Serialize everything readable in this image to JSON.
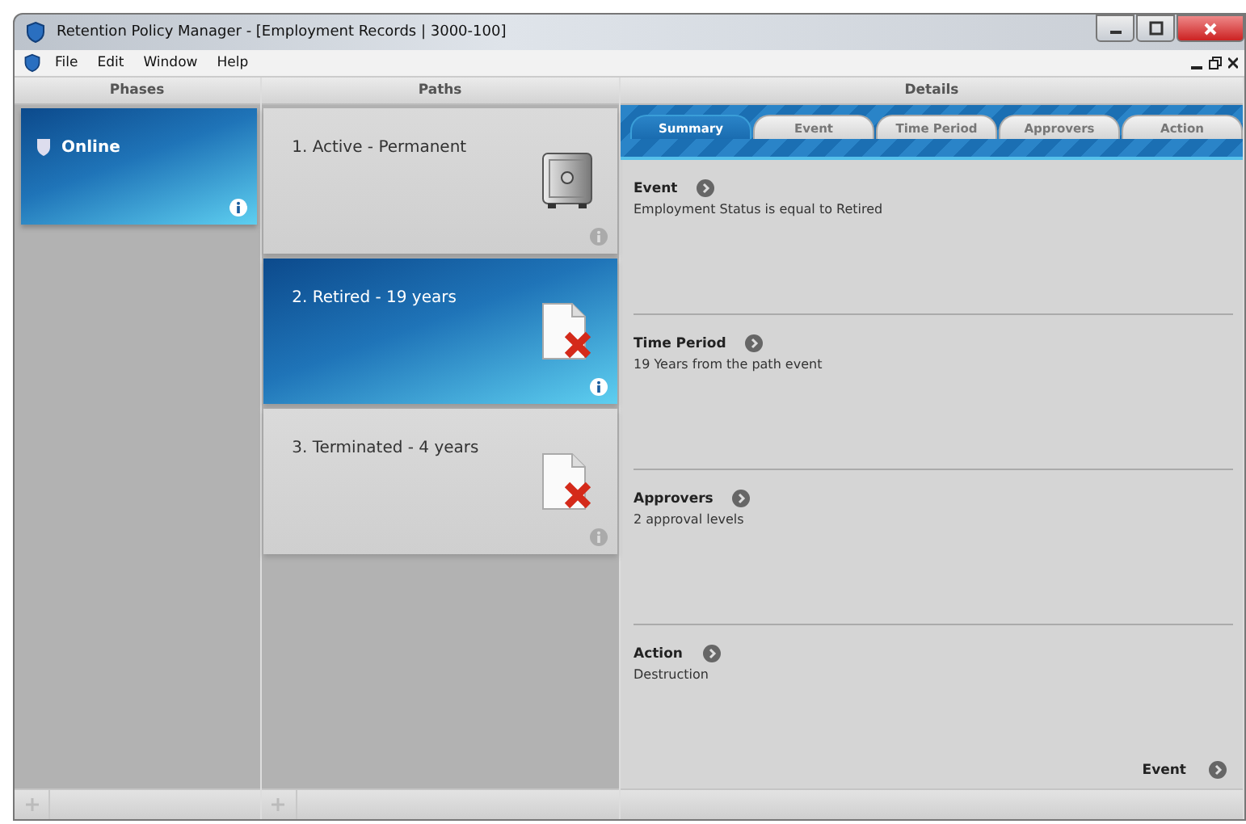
{
  "window": {
    "title": "Retention Policy Manager - [Employment Records | 3000-100]"
  },
  "menu": [
    "File",
    "Edit",
    "Window",
    "Help"
  ],
  "phases": {
    "heading": "Phases",
    "items": [
      {
        "label": "Online",
        "selected": true
      }
    ]
  },
  "paths": {
    "heading": "Paths",
    "items": [
      {
        "label": "1. Active - Permanent",
        "kind": "safe",
        "selected": false
      },
      {
        "label": "2. Retired - 19 years",
        "kind": "delete",
        "selected": true
      },
      {
        "label": "3. Terminated - 4 years",
        "kind": "delete",
        "selected": false
      }
    ]
  },
  "details": {
    "heading": "Details",
    "tabs": [
      {
        "label": "Summary",
        "selected": true
      },
      {
        "label": "Event",
        "selected": false
      },
      {
        "label": "Time Period",
        "selected": false
      },
      {
        "label": "Approvers",
        "selected": false
      },
      {
        "label": "Action",
        "selected": false
      }
    ],
    "sections": [
      {
        "title": "Event",
        "value": "Employment Status is equal to Retired"
      },
      {
        "title": "Time Period",
        "value": "19 Years from the path event"
      },
      {
        "title": "Approvers",
        "value": "2 approval levels"
      },
      {
        "title": "Action",
        "value": "Destruction"
      }
    ],
    "next": "Event"
  }
}
